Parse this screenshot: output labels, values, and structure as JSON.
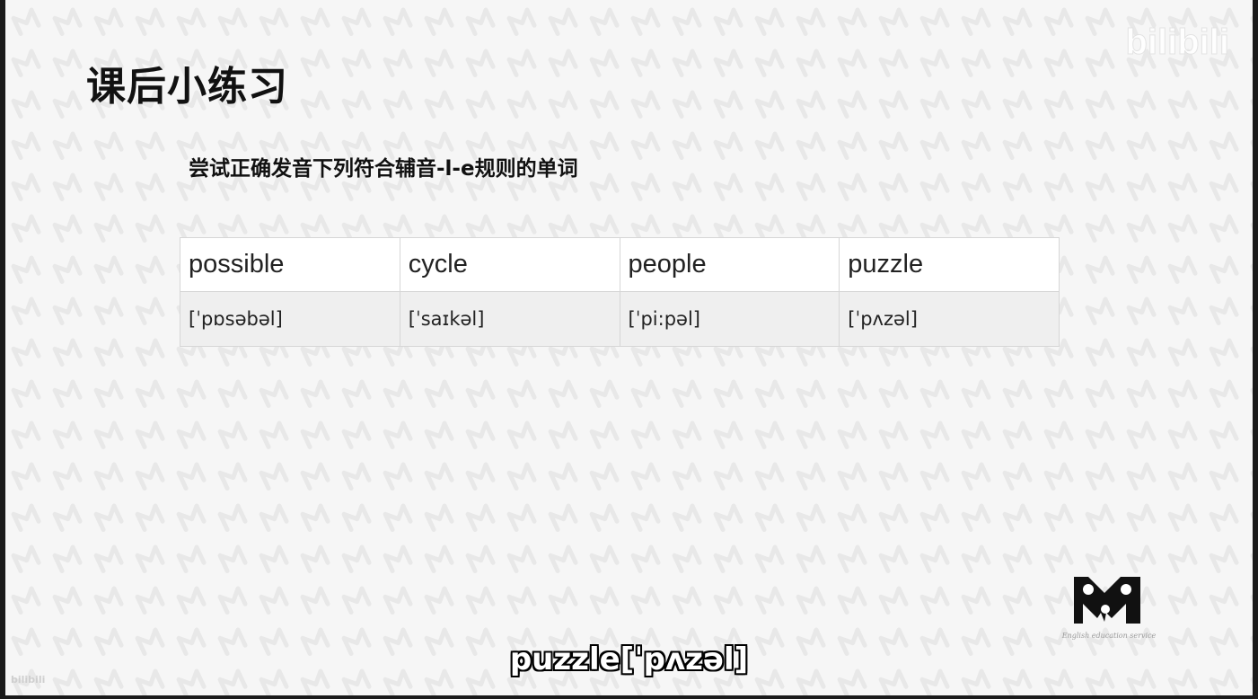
{
  "slide": {
    "title": "课后小练习",
    "instruction": "尝试正确发音下列符合辅音-l-e规则的单词",
    "words": [
      {
        "word": "possible",
        "ipa": "[ˈpɒsəbəl]"
      },
      {
        "word": "cycle",
        "ipa": "[ˈsaɪkəl]"
      },
      {
        "word": "people",
        "ipa": "[ˈpi:pəl]"
      },
      {
        "word": "puzzle",
        "ipa": "[ˈpʌzəl]"
      }
    ]
  },
  "watermark": {
    "platform_logo": "bilibili",
    "brand_logo_icon": "m-logo-icon",
    "brand_tagline": "English education service",
    "corner_mark": "bilibili"
  },
  "subtitle_caption": "puzzle[ˈpʌzəl]",
  "colors": {
    "background": "#f6f6f6",
    "text": "#111111",
    "table_border": "#d6d6d6",
    "ipa_row_bg": "#efefef"
  }
}
